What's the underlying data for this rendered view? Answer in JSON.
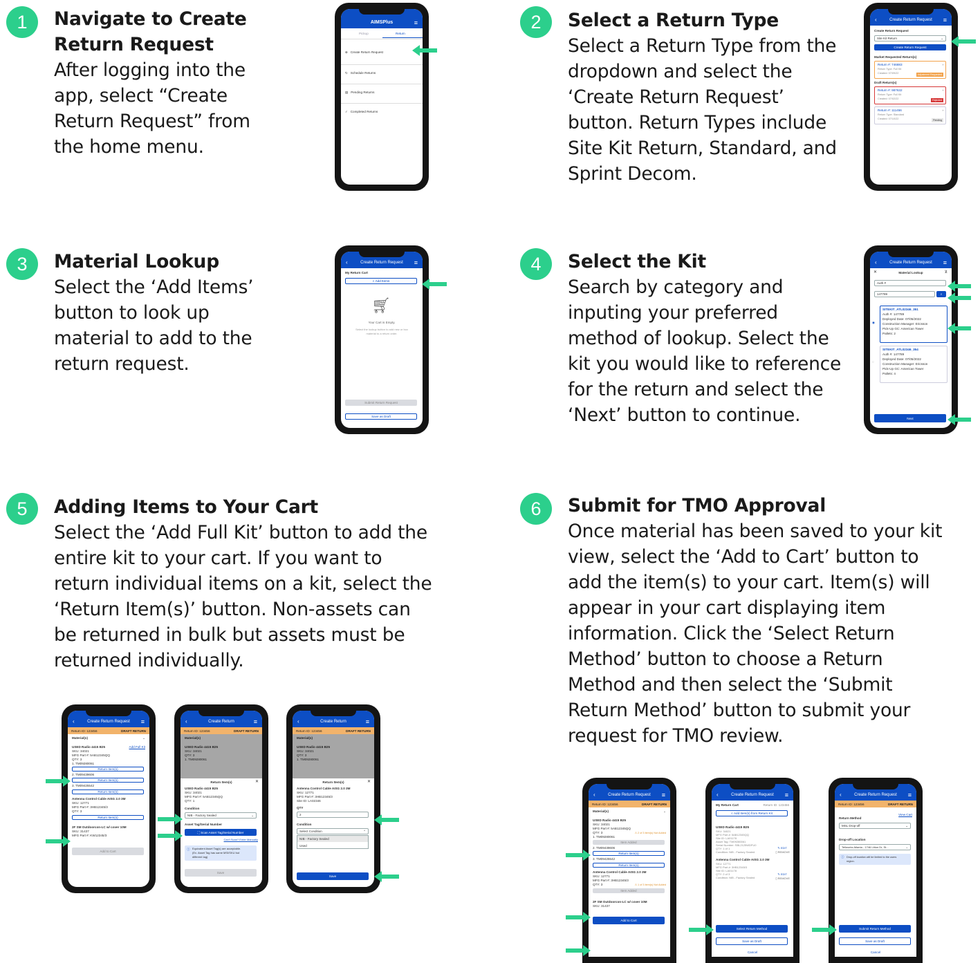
{
  "steps": [
    {
      "number": "1",
      "title": "Navigate to Create Return Request",
      "body": "After logging into the app, select “Create Return Request” from the home menu."
    },
    {
      "number": "2",
      "title": "Select a Return Type",
      "body": "Select a Return Type from the dropdown and select the ‘Create Return Request’ button. Return Types include Site Kit Return, Standard, and Sprint Decom."
    },
    {
      "number": "3",
      "title": "Material Lookup",
      "body": "Select the ‘Add Items’ button to look up material to add to the return request."
    },
    {
      "number": "4",
      "title": "Select the Kit",
      "body": "Search by category and inputing your preferred method of lookup. Select the kit you would like to reference for the return and select the ‘Next’ button to continue."
    },
    {
      "number": "5",
      "title": "Adding Items to Your Cart",
      "body": "Select the ‘Add Full Kit’ button to add the entire kit to your cart. If you want to return individual items on a kit, select the ‘Return Item(s)’ button. Non-assets can be returned in bulk but assets must be returned individually."
    },
    {
      "number": "6",
      "title": "Submit for TMO Approval",
      "body": "Once material has been saved to your kit view, select the ‘Add to Cart’ button to add the item(s) to your cart. Item(s) will appear in your cart displaying item information. Click the ‘Select Return Method’ button to choose a Return Method and then select the ‘Submit Return Method’ button to submit your request for TMO review."
    }
  ],
  "s1": {
    "logo": "AIMSPlus",
    "tabs": [
      "Pickup",
      "Return"
    ],
    "items": [
      "Create Return Request",
      "Schedule Returns",
      "Pending Returns",
      "Completed Returns"
    ]
  },
  "s2": {
    "title": "Create Return Request",
    "label": "Create Return Request",
    "select": "Site Kit Return",
    "btn": "Create Return Request",
    "h1": "Market Requested Return(s)",
    "h2": "Draft Return(s)",
    "cards": [
      {
        "id": "Return #: 746883",
        "type": "Return Type: Full Kit",
        "created": "Created: 07/09/22",
        "badge": "Adjustment Requested"
      },
      {
        "id": "Return #: 987632",
        "type": "Return Type: Full Kit",
        "created": "Created: 07/02/22",
        "badge": "Rejected"
      },
      {
        "id": "Return #: 111456",
        "type": "Return Type: Standard",
        "created": "Created: 07/10/22",
        "badge": "Pending"
      }
    ]
  },
  "s3": {
    "title": "Create Return Request",
    "cart": "My Return Cart",
    "add": "Add Items",
    "empty": "Your Cart is Empty.",
    "hint1": "Select the lookup button to add new or box",
    "hint2": "material to a return order.",
    "submit": "Submit Return Request",
    "draft": "Save as Draft"
  },
  "s4": {
    "title": "Create Return Request",
    "lookup": "Material Lookup",
    "cat": "Auth #",
    "val": "147789",
    "kits": [
      {
        "name": "SITEKIT_ATL02346_351",
        "l1": "Auth #: 147789",
        "l2": "Deployed Date: 07/05/2022",
        "l3": "Construction Manager: Ericsson",
        "l4": "Pick-Up GC: American Tower",
        "l5": "Pallets: 2"
      },
      {
        "name": "SITEKIT_ATL02346_354",
        "l1": "Auth #: 147789",
        "l2": "Deployed Date: 07/05/2022",
        "l3": "Construction Manager: Ericsson",
        "l4": "Pick-Up GC: American Tower",
        "l5": "Pallets: 4"
      }
    ],
    "next": "Next"
  },
  "s5": {
    "a": {
      "title": "Create Return Request",
      "rid": "Return ID: 123456",
      "draft": "DRAFT RETURN",
      "mat": "Material(s)",
      "addfull": "Add Full Kit",
      "l": [
        "USED Radio 4415 B25",
        "SKU: 34021",
        "MFG Part #: 5AB12345QQ",
        "QTY: 3",
        "1. TM09280061"
      ],
      "ret": "Return Item(s)",
      "i2": "2. TM09439606",
      "i3": "3. TM09425542",
      "l2": [
        "Antenna Control Cable AISG 2.0 3M",
        "SKU: 12771",
        "MFG Part #: 3HB12345/3",
        "QTY: 3"
      ],
      "l3": [
        "2F SM Outdoorcon-LC w/ cover 10M",
        "SKU: 31437",
        "MFG Part #: KW12345/3"
      ],
      "cart": "Add to Cart"
    },
    "b": {
      "title": "Create Return",
      "rid": "Return ID: 123456",
      "draft": "DRAFT RETURN",
      "mat": "Material(s)",
      "l": [
        "USED Radio 4415 B25",
        "SKU: 34021",
        "QTY: 3",
        "1. TM09280061"
      ],
      "modal": "Return Item(s)",
      "m": [
        "USED Radio 4415 B25",
        "SKU: 34021",
        "MFG Part #: 5AB12345QQ",
        "QTY: 1"
      ],
      "cond": "Condition",
      "condv": "NIB - Factory Sealed",
      "tag": "Asset Tag/Serial Number",
      "scan": "Scan Asset Tag/Serial Number",
      "manual": "Can't Scan? Enter Manually",
      "info1": "Equivalent Asset Tag(s) are acceptable.",
      "info2": "(Ex. Asset Tag has same MSI/SKU but",
      "info3": "different tag)",
      "save": "Save"
    },
    "c": {
      "title": "Create Return",
      "rid": "Return ID: 123456",
      "draft": "DRAFT RETURN",
      "mat": "Material(s)",
      "l": [
        "USED Radio 4415 B25",
        "SKU: 34021",
        "QTY: 3",
        "1. TM09280061"
      ],
      "modal": "Return Item(s)",
      "m": [
        "Antenna Control Cable AISG 2.0 3M",
        "SKU: 12771",
        "MFG Part #: 3HB12345/3",
        "Site ID: LA02346"
      ],
      "qty": "QTY",
      "qtyv": "2",
      "cond": "Condition",
      "sel": "Select Condition",
      "o1": "NIB - Factory Sealed",
      "o2": "Used",
      "save": "Save"
    }
  },
  "s6": {
    "a": {
      "title": "Create Return Request",
      "rid": "Return ID: 123456",
      "draft": "DRAFT RETURN",
      "mat": "Material(s)",
      "l": [
        "USED Radio 4415 B25",
        "SKU: 34021",
        "MFG Part #: 5AB12345QQ",
        "QTY: 3",
        "1. TM09280061"
      ],
      "warn1": "2 of 3 item(s) Not Added",
      "added": "Item Added",
      "i2": "2. TM09439606",
      "ret": "Return Item(s)",
      "i3": "3. TM09425542",
      "l2": [
        "Antenna Control Cable AISG 2.0 3M",
        "SKU: 12771",
        "MFG Part #: 3HB12345/3",
        "QTY: 3"
      ],
      "warn2": "1 of 3 item(s) Not Added",
      "l3": [
        "2F SM Outdoorcon-LC w/ cover 10M",
        "SKU: 31437"
      ],
      "cart": "Add to Cart"
    },
    "b": {
      "title": "Create Return Request",
      "cart": "My Return Cart",
      "rid": "Return ID: 123456",
      "add": "Add Item(s) from Return Kit",
      "l": [
        "USED Radio 4415 B25",
        "SKU: 34021",
        "MFG Part #: 5AB12345QQ",
        "Site ID: LA01178",
        "Asset Tag: TM09280061",
        "Serial Number: SBL2125WDFU0",
        "QTY: 1 of 1",
        "Condition: NIB - Factory Sealed"
      ],
      "l2": [
        "Antenna Control Cable AISG 2.0 3M",
        "SKU: 12771",
        "MFG Part #: 3HB12345/3",
        "Site ID: LA01178",
        "QTY: 2 of 3",
        "Condition: NIB - Factory Sealed"
      ],
      "edit": "EDIT",
      "remove": "REMOVE",
      "method": "Select Return Method",
      "draft": "Save as Draft",
      "cancel": "Cancel"
    },
    "c": {
      "title": "Create Return Request",
      "rid": "Return ID: 123456",
      "draft": "DRAFT RETURN",
      "rm": "Return Method",
      "view": "View Cart",
      "rmv": "MSL Drop-off",
      "dl": "Drop-off Location",
      "dlv": "Tellworks Atlanta - 1746 Litton Dr, St...",
      "info1": "Drop-off location will be limited to the users",
      "info2": "region.",
      "submit": "Submit Return Method",
      "save": "Save as Draft",
      "cancel": "Cancel"
    }
  },
  "colors": {
    "accent": "#2ccf8c",
    "brand": "#0d4ec4",
    "header_orange": "#f2b36b"
  }
}
